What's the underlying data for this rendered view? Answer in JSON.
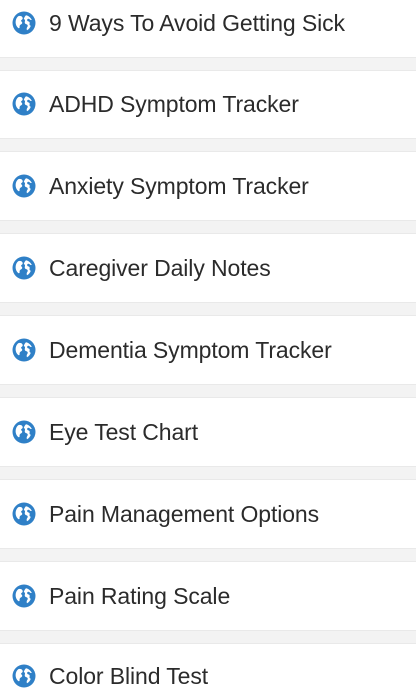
{
  "links": [
    {
      "label": "9 Ways To Avoid Getting Sick",
      "icon": "globe-icon"
    },
    {
      "label": "ADHD Symptom Tracker",
      "icon": "globe-icon"
    },
    {
      "label": "Anxiety Symptom Tracker",
      "icon": "globe-icon"
    },
    {
      "label": "Caregiver Daily Notes",
      "icon": "globe-icon"
    },
    {
      "label": "Dementia Symptom Tracker",
      "icon": "globe-icon"
    },
    {
      "label": "Eye Test Chart",
      "icon": "globe-icon"
    },
    {
      "label": "Pain Management Options",
      "icon": "globe-icon"
    },
    {
      "label": "Pain Rating Scale",
      "icon": "globe-icon"
    },
    {
      "label": "Color Blind Test",
      "icon": "globe-icon"
    }
  ],
  "colors": {
    "icon": "#2f80c7",
    "text": "#2b2b2b",
    "separator": "#f3f3f3"
  }
}
